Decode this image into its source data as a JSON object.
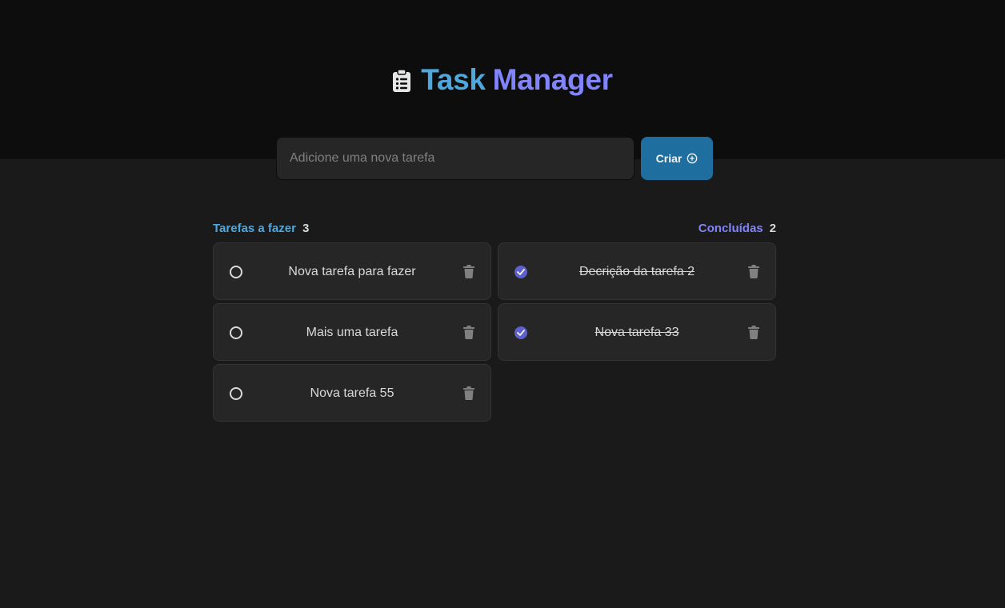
{
  "app": {
    "title_word1": "Task",
    "title_word2": "Manager",
    "logo_icon": "clipboard-list-icon"
  },
  "form": {
    "placeholder": "Adicione uma nova tarefa",
    "value": "",
    "create_label": "Criar",
    "create_icon": "plus-circle-icon"
  },
  "todo": {
    "label": "Tarefas a fazer",
    "count": "3",
    "items": [
      {
        "text": "Nova tarefa para fazer",
        "done": false
      },
      {
        "text": "Mais uma tarefa",
        "done": false
      },
      {
        "text": "Nova tarefa 55",
        "done": false
      }
    ]
  },
  "done": {
    "label": "Concluídas",
    "count": "2",
    "items": [
      {
        "text": "Decrição da tarefa 2",
        "done": true
      },
      {
        "text": "Nova tarefa 33",
        "done": true
      }
    ]
  },
  "colors": {
    "blue": "#4ea8de",
    "purple": "#8284fa",
    "button": "#1e6f9f",
    "checked": "#5e60ce",
    "background": "#1a1a1a",
    "header": "#0d0d0d",
    "card": "#262626"
  }
}
